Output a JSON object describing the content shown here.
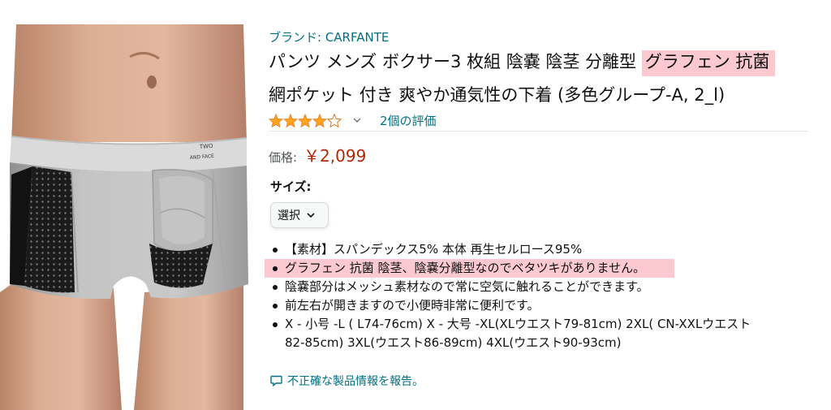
{
  "product": {
    "brand_label": "ブランド: CARFANTE",
    "title_line1_plain": "パンツ メンズ ボクサー3 枚組 陰嚢 陰茎 分離型 ",
    "title_line1_highlight": "グラフェン 抗菌",
    "title_line2": "網ポケット 付き 爽やか通気性の下着 (多色グループ-A, 2_l)",
    "rating": {
      "stars_value": 4.0,
      "stars_max": 5,
      "chevron_icon": "chevron-down-icon",
      "count_text": "2個の評価"
    },
    "price_label": "価格:",
    "price_value": "￥2,099",
    "size_label": "サイズ:",
    "size_select_value": "選択",
    "bullets": [
      "【素材】スパンデックス5% 本体 再生セルロース95%",
      "グラフェン 抗菌 陰茎、陰嚢分離型なのでベタツキがありません。",
      "陰嚢部分はメッシュ素材なので常に空気に触れることができます。",
      "前左右が開きますので小便時非常に便利です。",
      "X - 小号 -L ( L74-76cm) X - 大号 -XL(XLウエスト79-81cm) 2XL( CN-XXLウエスト",
      "82-85cm) 3XL(ウエスト86-89cm) 4XL(ウエスト90-93cm)"
    ],
    "highlighted_bullet_index": 1,
    "report_link": "不正確な製品情報を報告。",
    "report_icon": "comment-icon",
    "image_waistband_text": [
      "TWO",
      "AND FACE"
    ]
  },
  "colors": {
    "link": "#007185",
    "price": "#b12704",
    "star": "#ffa41c",
    "highlight": "#fbc9cf",
    "garment_gray": "#b9b9b9",
    "mesh_black": "#1b1b1b",
    "skin": "#d6a98c"
  }
}
